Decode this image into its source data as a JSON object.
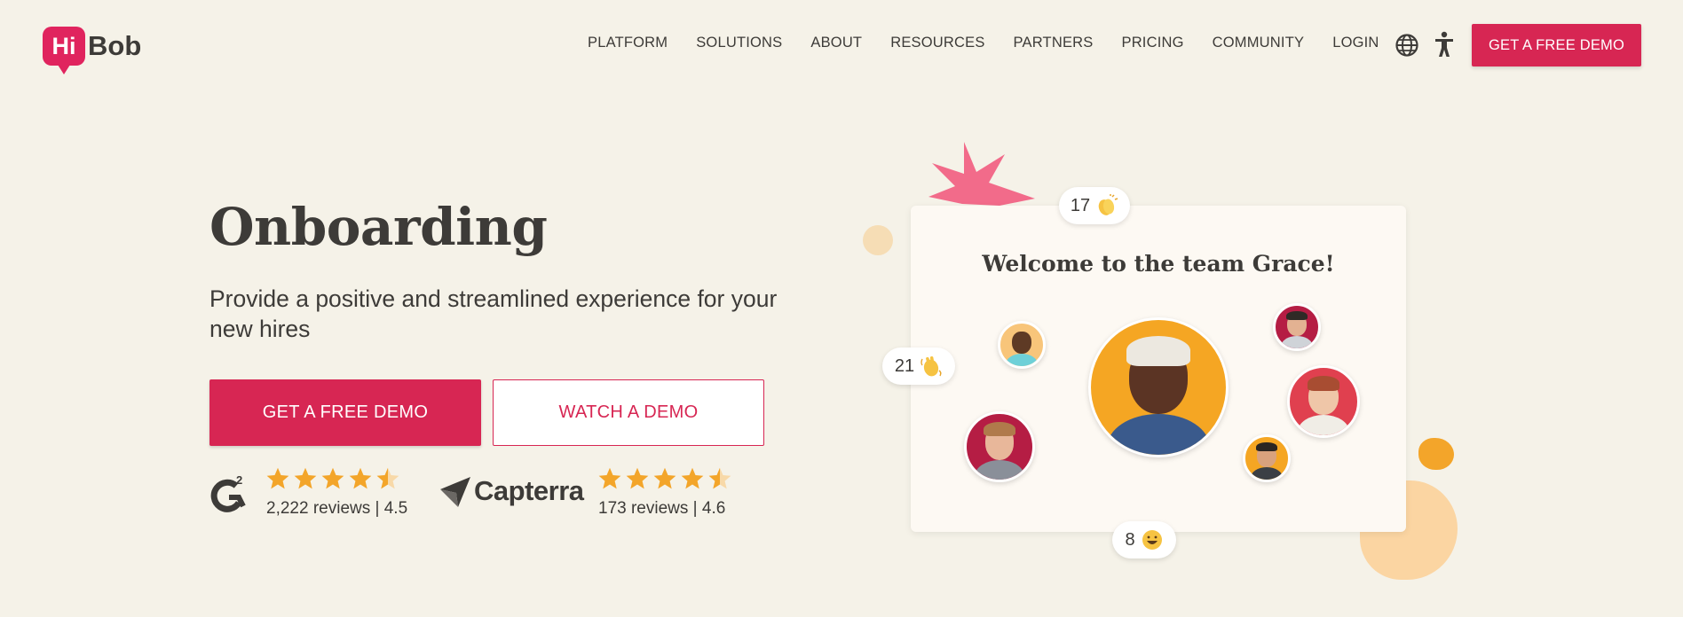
{
  "brand": {
    "logo_hi": "Hi",
    "logo_bob": "Bob",
    "accent": "#d72653"
  },
  "nav": {
    "items": [
      "PLATFORM",
      "SOLUTIONS",
      "ABOUT",
      "RESOURCES",
      "PARTNERS",
      "PRICING",
      "COMMUNITY",
      "LOGIN"
    ],
    "globe_icon": "globe-icon",
    "accessibility_icon": "accessibility-icon",
    "cta_label": "GET A FREE DEMO"
  },
  "hero": {
    "title": "Onboarding",
    "subtitle": "Provide a positive and streamlined experience for your new hires",
    "primary_cta": "GET A FREE DEMO",
    "secondary_cta": "WATCH A DEMO"
  },
  "ratings": {
    "g2": {
      "logo": "G2",
      "stars": 4.5,
      "text": "2,222 reviews | 4.5"
    },
    "capterra": {
      "logo": "Capterra",
      "stars": 4.5,
      "text": "173 reviews | 4.6"
    }
  },
  "illustration": {
    "card_title": "Welcome to the team Grace!",
    "reactions": [
      {
        "count": "17",
        "emoji": "clapping-hands-icon"
      },
      {
        "count": "21",
        "emoji": "waving-hand-icon"
      },
      {
        "count": "8",
        "emoji": "smiling-face-icon"
      }
    ]
  }
}
